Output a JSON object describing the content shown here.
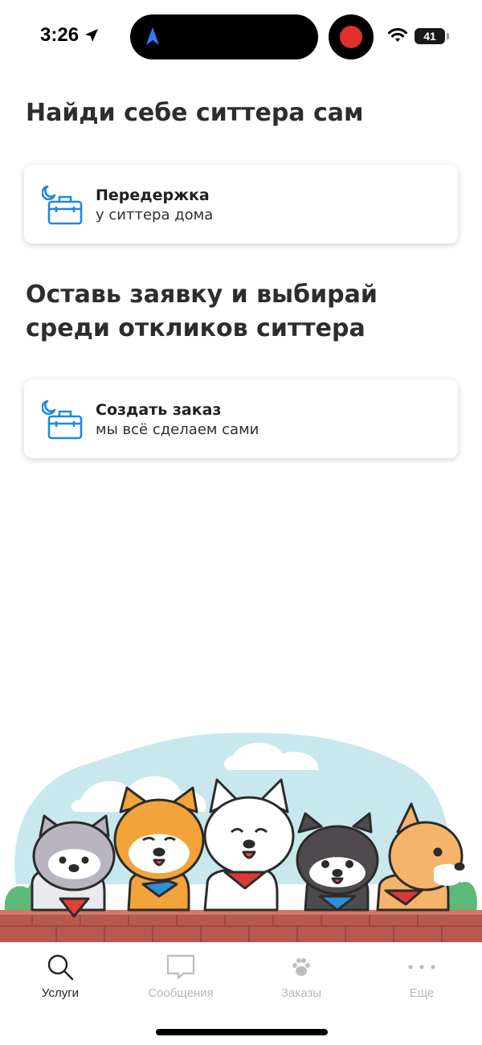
{
  "status_bar": {
    "time": "3:26",
    "battery": "41"
  },
  "sections": [
    {
      "title": "Найди себе ситтера сам",
      "card": {
        "title": "Передержка",
        "subtitle": "у ситтера дома",
        "icon": "bag-moon-icon"
      }
    },
    {
      "title": "Оставь заявку и выбирай среди откликов ситтера",
      "card": {
        "title": "Создать заказ",
        "subtitle": "мы всё сделаем сами",
        "icon": "bag-moon-icon"
      }
    }
  ],
  "illustration": {
    "subject": "dogs-illustration"
  },
  "tab_bar": {
    "items": [
      {
        "label": "Услуги",
        "icon": "search-icon",
        "active": true
      },
      {
        "label": "Сообщения",
        "icon": "message-icon",
        "active": false
      },
      {
        "label": "Заказы",
        "icon": "paw-icon",
        "active": false
      },
      {
        "label": "Еще",
        "icon": "more-icon",
        "active": false
      }
    ]
  },
  "colors": {
    "accent": "#1e88e5",
    "text": "#2d2d2d",
    "inactive_tab": "#b8b8b8",
    "recording": "#e0302b"
  }
}
